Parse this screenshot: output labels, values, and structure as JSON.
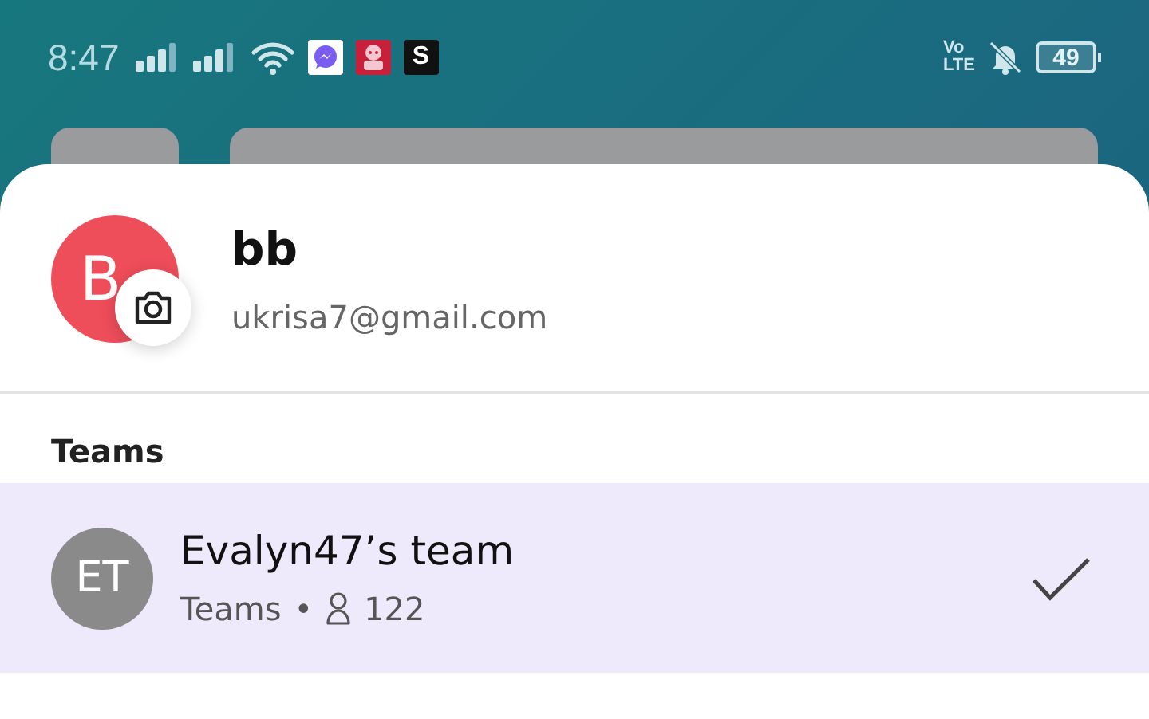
{
  "status_bar": {
    "time": "8:47",
    "notification_badge": "S",
    "network_label_top": "Vo",
    "network_label_bottom": "LTE",
    "battery": "49"
  },
  "profile": {
    "avatar_initial": "B",
    "name": "bb",
    "email": "ukrisa7@gmail.com"
  },
  "teams_heading": "Teams",
  "teams": [
    {
      "initials": "ET",
      "name": "Evalyn47’s team",
      "kind_label": "Teams",
      "separator": "•",
      "members": "122",
      "selected": true
    }
  ]
}
